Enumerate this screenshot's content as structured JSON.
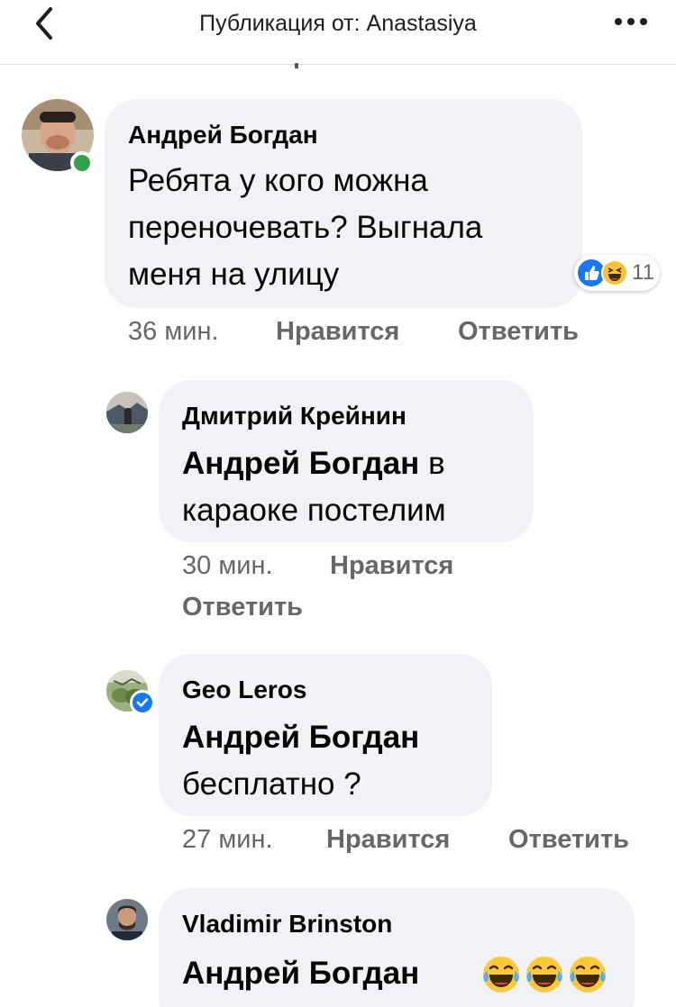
{
  "header": {
    "title": "Публикация от: Anastasiya"
  },
  "comments": [
    {
      "author": "Андрей Богдан",
      "lines": [
        "Ребята у кого можна",
        "переночевать? Выгнала",
        "меня на улицу"
      ],
      "time": "36 мин.",
      "like_label": "Нравится",
      "reply_label": "Ответить",
      "reactions_count": "11",
      "reaction_icons": [
        "like-icon",
        "laugh-icon"
      ]
    },
    {
      "author": "Дмитрий Крейнин",
      "mention": "Андрей Богдан",
      "text_after_mention": "в",
      "line2": "караоке постелим",
      "time": "30 мин.",
      "like_label": "Нравится",
      "reply_label": "Ответить"
    },
    {
      "author": "Geo Leros",
      "mention": "Андрей Богдан",
      "line2": "бесплатно ?",
      "time": "27 мин.",
      "like_label": "Нравится",
      "reply_label": "Ответить"
    },
    {
      "author": "Vladimir Brinston",
      "mention": "Андрей Богдан",
      "emoji": [
        "laughing-tears-emoji",
        "laughing-tears-emoji",
        "laughing-tears-emoji"
      ]
    }
  ],
  "colors": {
    "bubble": "#f0f2f5",
    "meta_text": "#65676b",
    "online": "#31a24c",
    "verified": "#1877f2"
  }
}
